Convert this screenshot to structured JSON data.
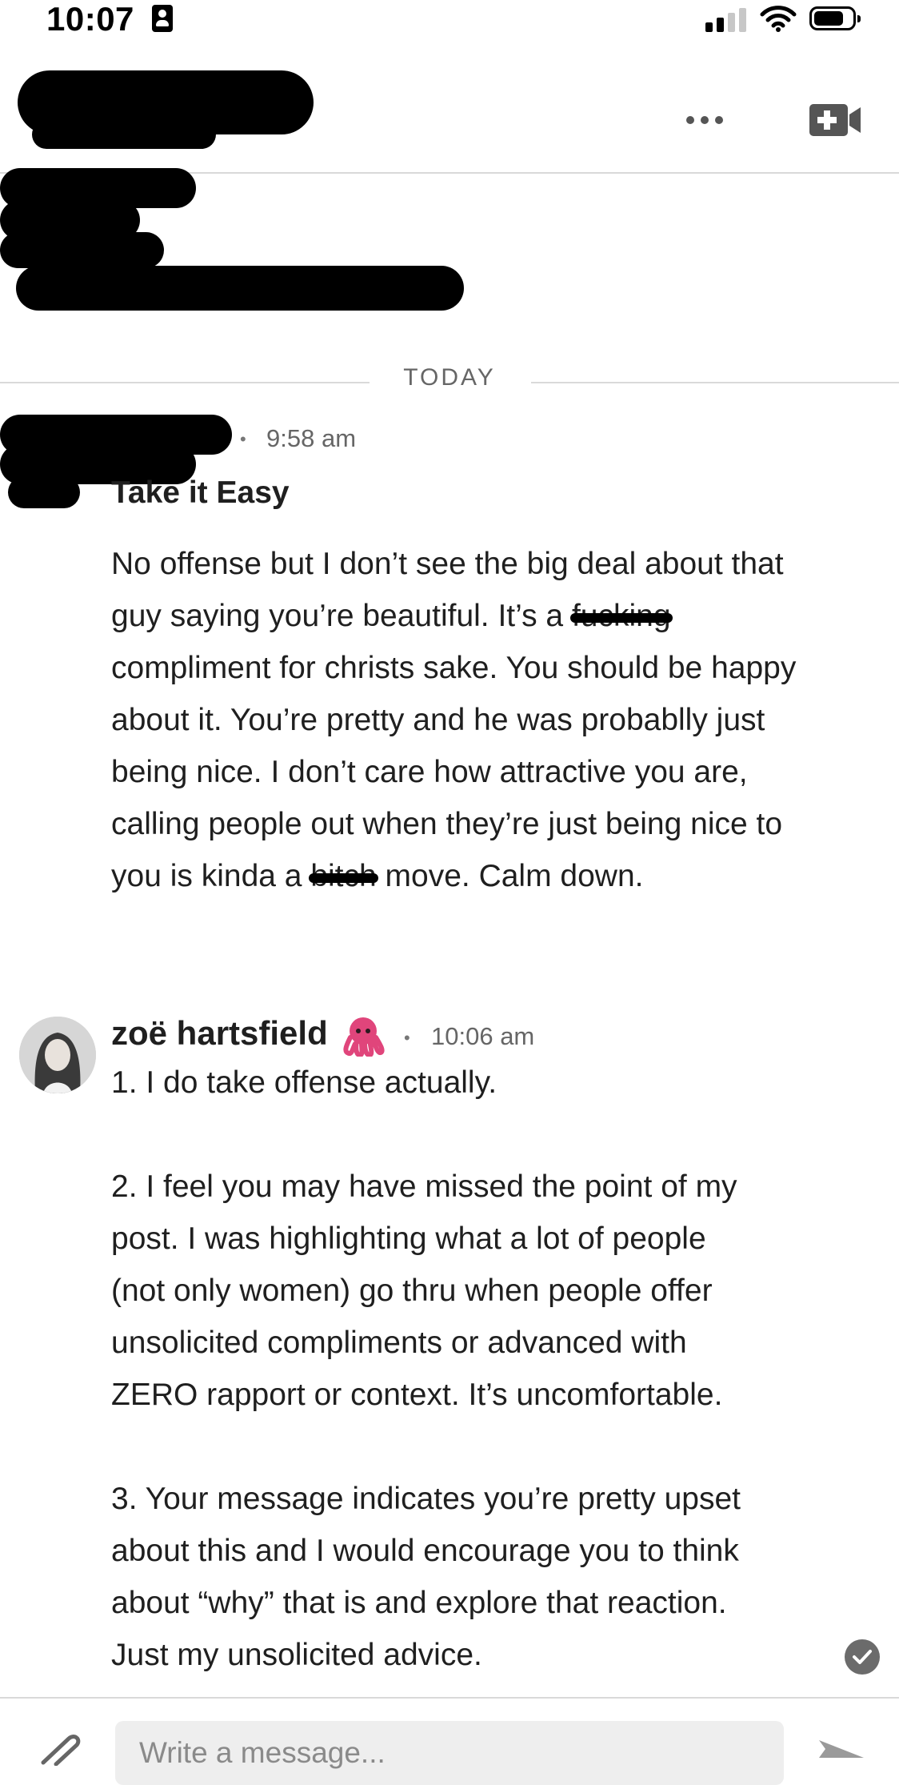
{
  "status_bar": {
    "time": "10:07"
  },
  "header": {
    "more_icon": "ellipsis-icon",
    "video_icon": "video-plus-icon"
  },
  "thread": {
    "day_label": "TODAY"
  },
  "messages": [
    {
      "time": "9:58 am",
      "subject": "Take it Easy",
      "body_part1": "No offense but I don’t see the big deal about that\nguy saying you’re beautiful. It’s a ",
      "censor1": "fucking",
      "body_part2": "\ncompliment for christs sake. You should be happy\nabout it. You’re pretty and he was probablly just\nbeing nice. I don’t care how attractive you are,\ncalling people out when they’re just being nice to\nyou is kinda a ",
      "censor2": "bitch",
      "body_part3": " move. Calm down."
    },
    {
      "sender": "zoë hartsfield",
      "emoji": "🐙",
      "time": "10:06 am",
      "body": "1. I do take offense actually.\n\n2. I feel you may have missed the point of my\npost. I was highlighting what a lot of people\n(not only women) go thru when people offer\nunsolicited compliments or advanced with\nZERO rapport or context. It’s uncomfortable.\n\n3. Your message indicates you’re pretty upset\nabout this and I would encourage you to think\nabout “why” that is and explore that reaction.\nJust my unsolicited advice."
    }
  ],
  "composer": {
    "placeholder": "Write a message...",
    "attach_icon": "paperclip-icon",
    "send_icon": "send-icon"
  },
  "colors": {
    "accent_text": "#1f1f1f",
    "muted": "#666666",
    "divider": "#d9d9d9"
  }
}
